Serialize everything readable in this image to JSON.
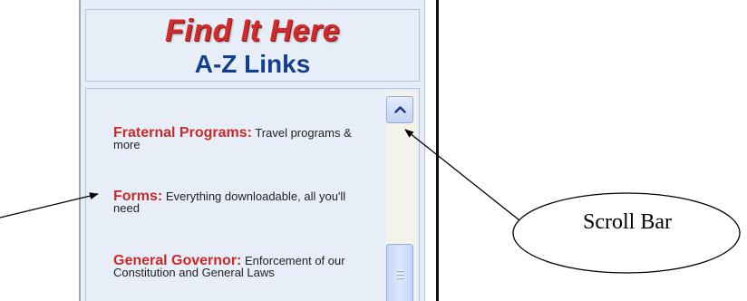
{
  "header": {
    "title": "Find It Here",
    "subtitle": "A-Z Links"
  },
  "links": [
    {
      "title": "Fraternal Programs:",
      "description": "Travel programs & more"
    },
    {
      "title": "Forms:",
      "description": "Everything downloadable, all you'll need"
    },
    {
      "title": "General Governor:",
      "description": "Enforcement of our Constitution and General Laws"
    }
  ],
  "annotations": {
    "callout_label": "Scroll Bar"
  },
  "icons": {
    "scroll_up": "chevron-up-icon",
    "thumb_grip": "grip-lines-icon"
  },
  "colors": {
    "title_red": "#d12a2a",
    "subtitle_blue": "#123f8f",
    "link_red": "#c92a2a",
    "panel_bg": "#e6edf8"
  }
}
